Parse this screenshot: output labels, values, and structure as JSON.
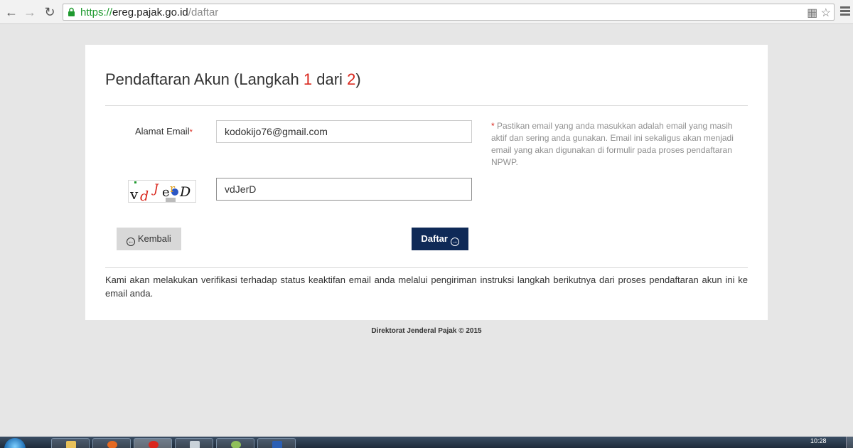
{
  "browser": {
    "url_scheme": "https://",
    "url_host": "ereg.pajak.go.id",
    "url_path": "/daftar"
  },
  "form": {
    "title_prefix": "Pendaftaran Akun  (Langkah ",
    "step_current": "1",
    "title_middle": " dari ",
    "step_total": "2",
    "title_suffix": ")",
    "email_label": "Alamat Email",
    "required_mark": "*",
    "email_value": "kodokijo76@gmail.com",
    "captcha_value": "vdJerD",
    "help_text": "Pastikan email yang anda masukkan adalah email yang masih aktif dan sering anda gunakan. Email ini sekaligus akan menjadi email yang akan digunakan di formulir pada proses pendaftaran NPWP.",
    "back_button": "Kembali",
    "next_button": "Daftar",
    "info_text": "Kami akan melakukan verifikasi terhadap status keaktifan email anda melalui pengiriman instruksi langkah berikutnya dari proses pendaftaran akun ini ke email anda."
  },
  "footer": {
    "text": "Direktorat Jenderal Pajak © 2015"
  },
  "taskbar": {
    "clock": "10:28"
  },
  "colors": {
    "accent_red": "#d9261c",
    "button_navy": "#0f2a57",
    "secure_green": "#1f9a2f"
  }
}
